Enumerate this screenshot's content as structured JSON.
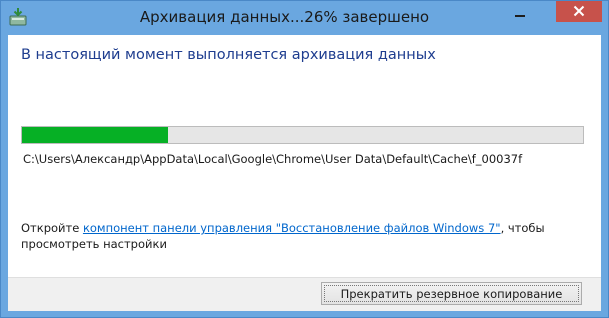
{
  "window": {
    "title": "Архивация данных...26% завершено",
    "app_icon": "backup-restore-icon",
    "minimize_icon": "minimize-icon",
    "close_icon": "close-icon",
    "close_color": "#c7524b",
    "titlebar_color": "#6aa7e0"
  },
  "content": {
    "heading": "В настоящий момент выполняется архивация данных",
    "progress": {
      "percent": 26,
      "fill_color": "#06b025"
    },
    "file_path": "C:\\Users\\Александр\\AppData\\Local\\Google\\Chrome\\User Data\\Default\\Cache\\f_00037f",
    "info": {
      "prefix": "Откройте ",
      "link": "компонент панели управления \"Восстановление файлов Windows 7\"",
      "suffix": ", чтобы просмотреть настройки"
    }
  },
  "footer": {
    "stop_button": "Прекратить резервное копирование"
  }
}
